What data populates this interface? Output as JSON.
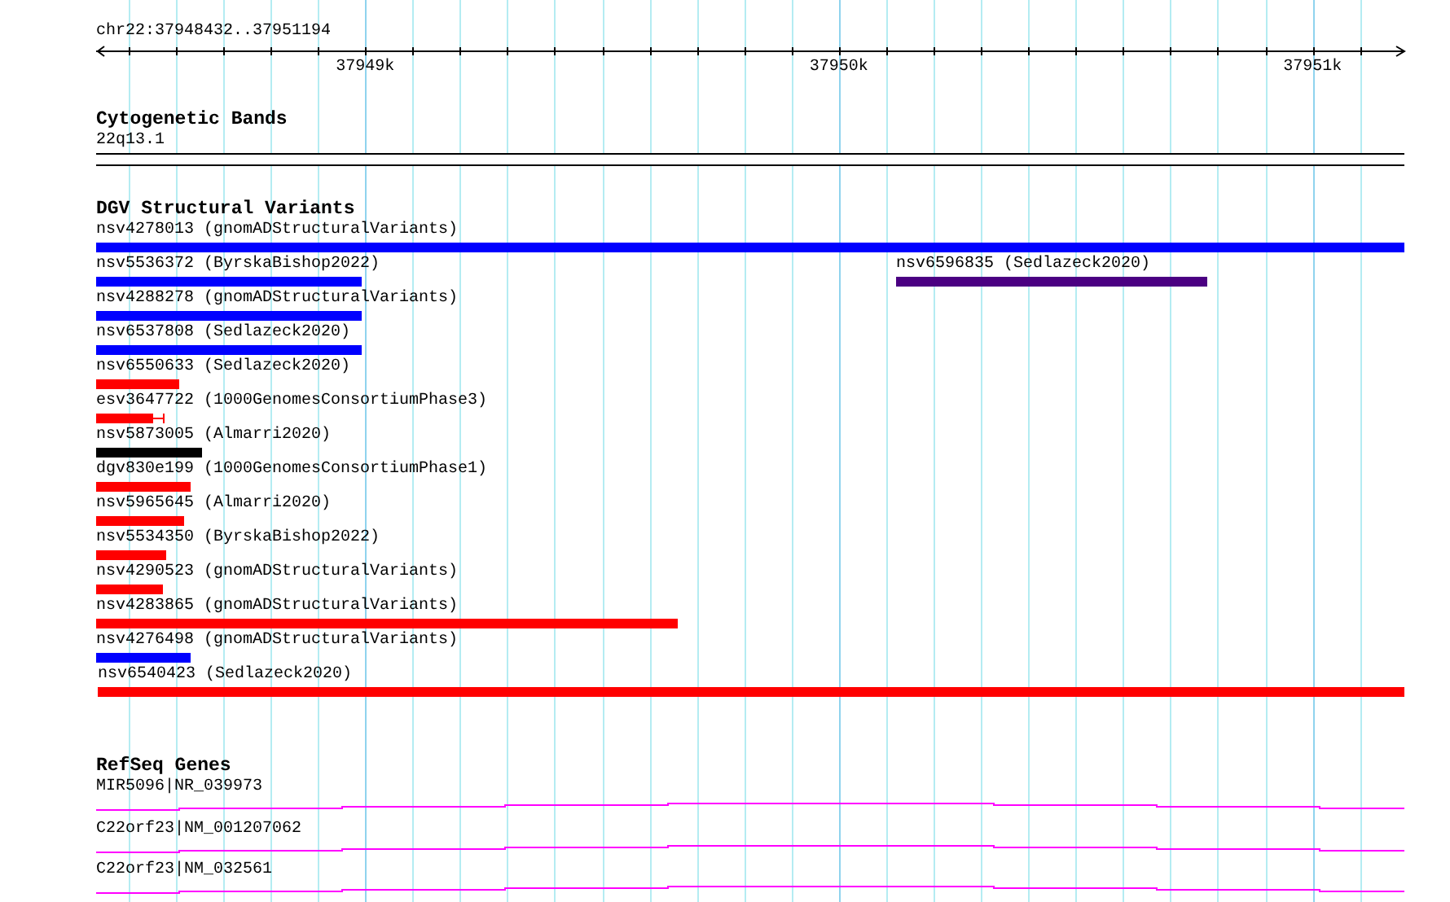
{
  "ruler": {
    "location": "chr22:37948432..37951194",
    "labels": [
      "37949k",
      "37950k",
      "37951k"
    ]
  },
  "tracks": [
    {
      "kind": "cytoband",
      "title": "Cytogenetic Bands",
      "band": "22q13.1"
    },
    {
      "kind": "variants",
      "title": "DGV Structural Variants",
      "rows": [
        {
          "features": [
            {
              "label": "nsv4278013 (gnomADStructuralVariants)",
              "color": "#0000ff"
            }
          ]
        },
        {
          "features": [
            {
              "label": "nsv5536372 (ByrskaBishop2022)",
              "color": "#0000ff"
            },
            {
              "label": "nsv6596835 (Sedlazeck2020)",
              "color": "#4b0082"
            }
          ]
        },
        {
          "features": [
            {
              "label": "nsv4288278 (gnomADStructuralVariants)",
              "color": "#0000ff"
            }
          ]
        },
        {
          "features": [
            {
              "label": "nsv6537808 (Sedlazeck2020)",
              "color": "#0000ff"
            }
          ]
        },
        {
          "features": [
            {
              "label": "nsv6550633 (Sedlazeck2020)",
              "color": "#ff0000"
            }
          ]
        },
        {
          "features": [
            {
              "label": "esv3647722 (1000GenomesConsortiumPhase3)",
              "color": "#ff0000"
            }
          ]
        },
        {
          "features": [
            {
              "label": "nsv5873005 (Almarri2020)",
              "color": "#000000"
            }
          ]
        },
        {
          "features": [
            {
              "label": "dgv830e199 (1000GenomesConsortiumPhase1)",
              "color": "#ff0000"
            }
          ]
        },
        {
          "features": [
            {
              "label": "nsv5965645 (Almarri2020)",
              "color": "#ff0000"
            }
          ]
        },
        {
          "features": [
            {
              "label": "nsv5534350 (ByrskaBishop2022)",
              "color": "#ff0000"
            }
          ]
        },
        {
          "features": [
            {
              "label": "nsv4290523 (gnomADStructuralVariants)",
              "color": "#ff0000"
            }
          ]
        },
        {
          "features": [
            {
              "label": "nsv4283865 (gnomADStructuralVariants)",
              "color": "#ff0000"
            }
          ]
        },
        {
          "features": [
            {
              "label": "nsv4276498 (gnomADStructuralVariants)",
              "color": "#0000ff"
            }
          ]
        },
        {
          "features": [
            {
              "label": "nsv6540423 (Sedlazeck2020)",
              "color": "#ff0000"
            }
          ]
        }
      ]
    },
    {
      "kind": "genes",
      "title": "RefSeq Genes",
      "genes": [
        {
          "label": "MIR5096|NR_039973"
        },
        {
          "label": "C22orf23|NM_001207062"
        },
        {
          "label": "C22orf23|NM_032561"
        }
      ]
    }
  ]
}
